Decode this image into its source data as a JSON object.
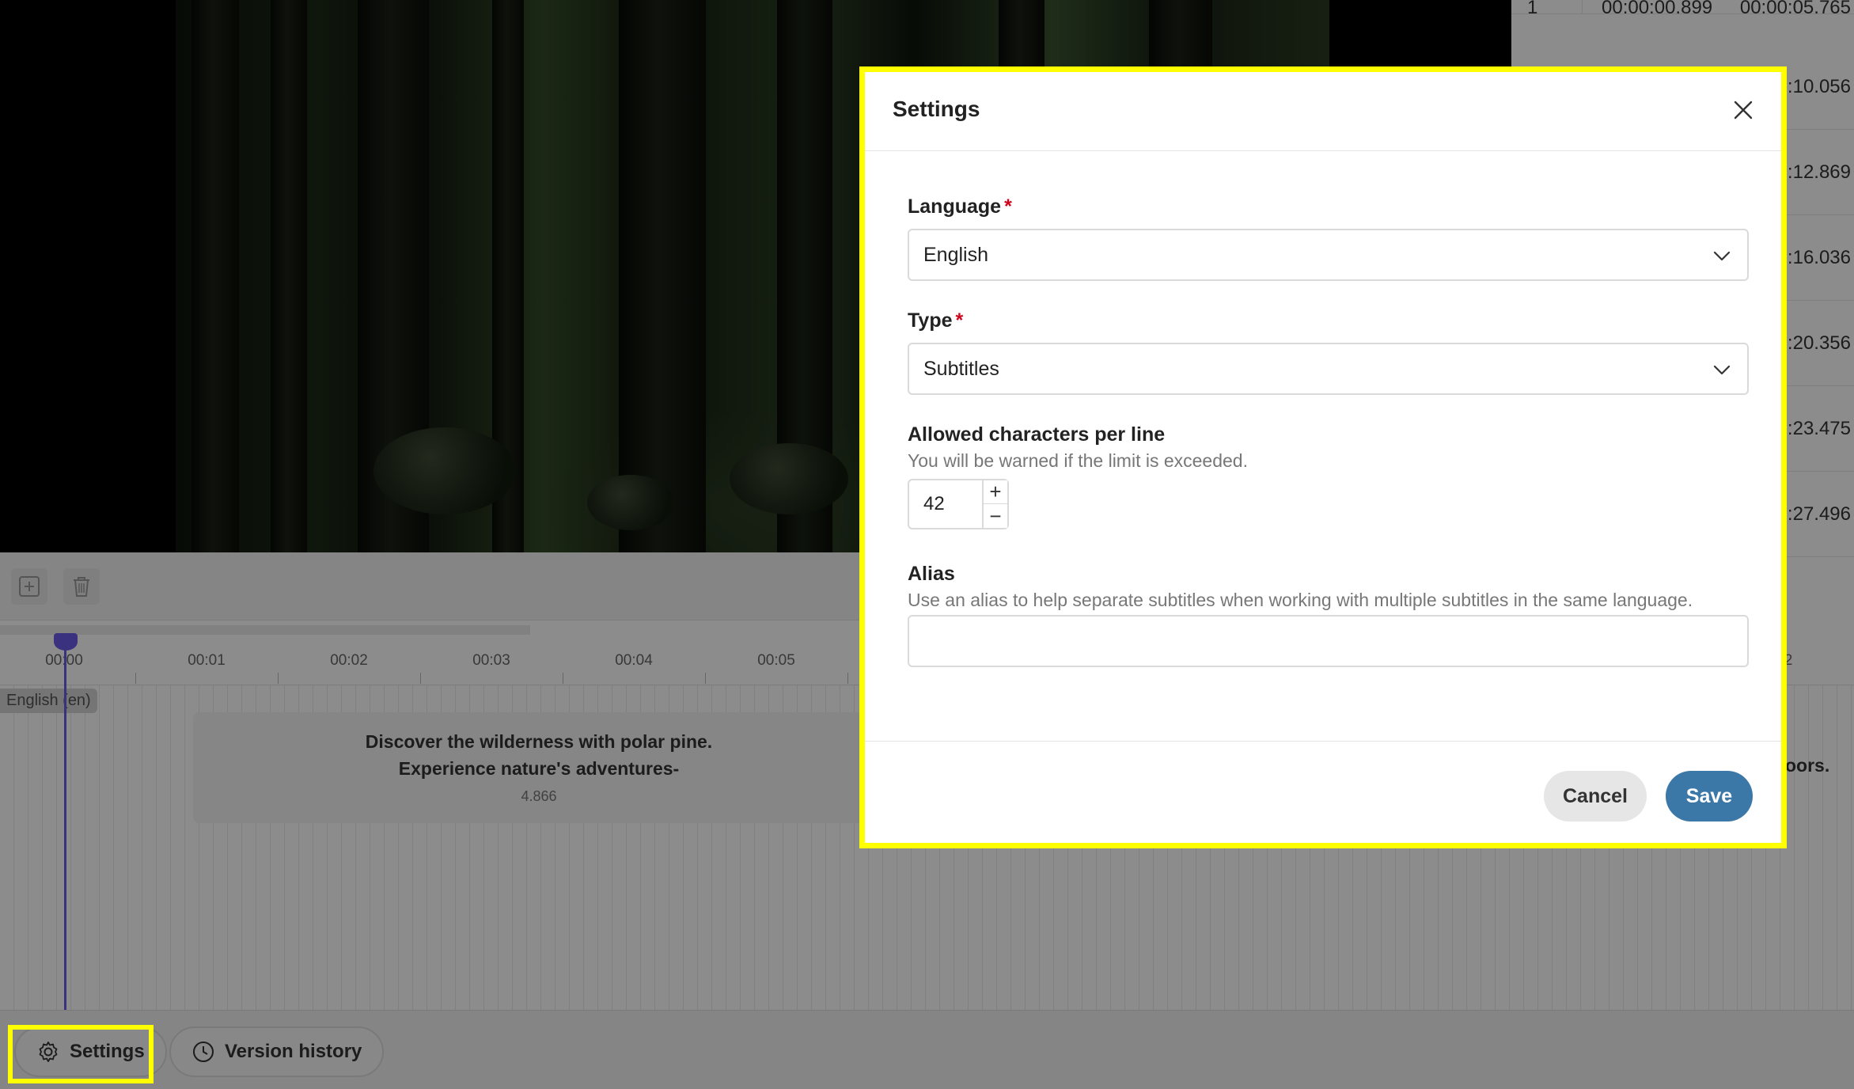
{
  "subtitle_table": {
    "rows": [
      {
        "index": "1",
        "start": "00:00:00.899",
        "end": "00:00:05.765"
      },
      {
        "index": "",
        "start": "",
        "end": ":10.056"
      },
      {
        "index": "",
        "start": "",
        "end": ":12.869"
      },
      {
        "index": "",
        "start": "",
        "end": ":16.036"
      },
      {
        "index": "",
        "start": "",
        "end": ":20.356"
      },
      {
        "index": "",
        "start": "",
        "end": ":23.475"
      },
      {
        "index": "",
        "start": "",
        "end": ":27.496"
      }
    ]
  },
  "timeline": {
    "ticks": [
      "00:00",
      "00:01",
      "00:02",
      "00:03",
      "00:04",
      "00:05"
    ],
    "tick_right": "2",
    "track_label": "English (en)",
    "cue": {
      "text": "Discover the wilderness with polar pine.\nExperience nature's adventures-",
      "duration": "4.866"
    },
    "cue_right_text": "oors."
  },
  "bottom_bar": {
    "settings_label": "Settings",
    "version_history_label": "Version history"
  },
  "modal": {
    "title": "Settings",
    "language": {
      "label": "Language",
      "required_mark": "*",
      "value": "English"
    },
    "type": {
      "label": "Type",
      "required_mark": "*",
      "value": "Subtitles"
    },
    "chars_per_line": {
      "label": "Allowed characters per line",
      "hint": "You will be warned if the limit is exceeded.",
      "value": "42",
      "increment": "+",
      "decrement": "−"
    },
    "alias": {
      "label": "Alias",
      "hint": "Use an alias to help separate subtitles when working with multiple subtitles in the same language.",
      "value": ""
    },
    "cancel_label": "Cancel",
    "save_label": "Save"
  },
  "icons": {
    "settings": "gear-icon",
    "version_history": "clock-icon",
    "close": "close-icon",
    "dropdown": "chevron-down-icon",
    "add": "plus-icon",
    "delete": "trash-icon"
  },
  "colors": {
    "highlight": "#ffff00",
    "primary": "#3b78a8",
    "playhead": "#6c5ce7",
    "required": "#d0021b"
  }
}
